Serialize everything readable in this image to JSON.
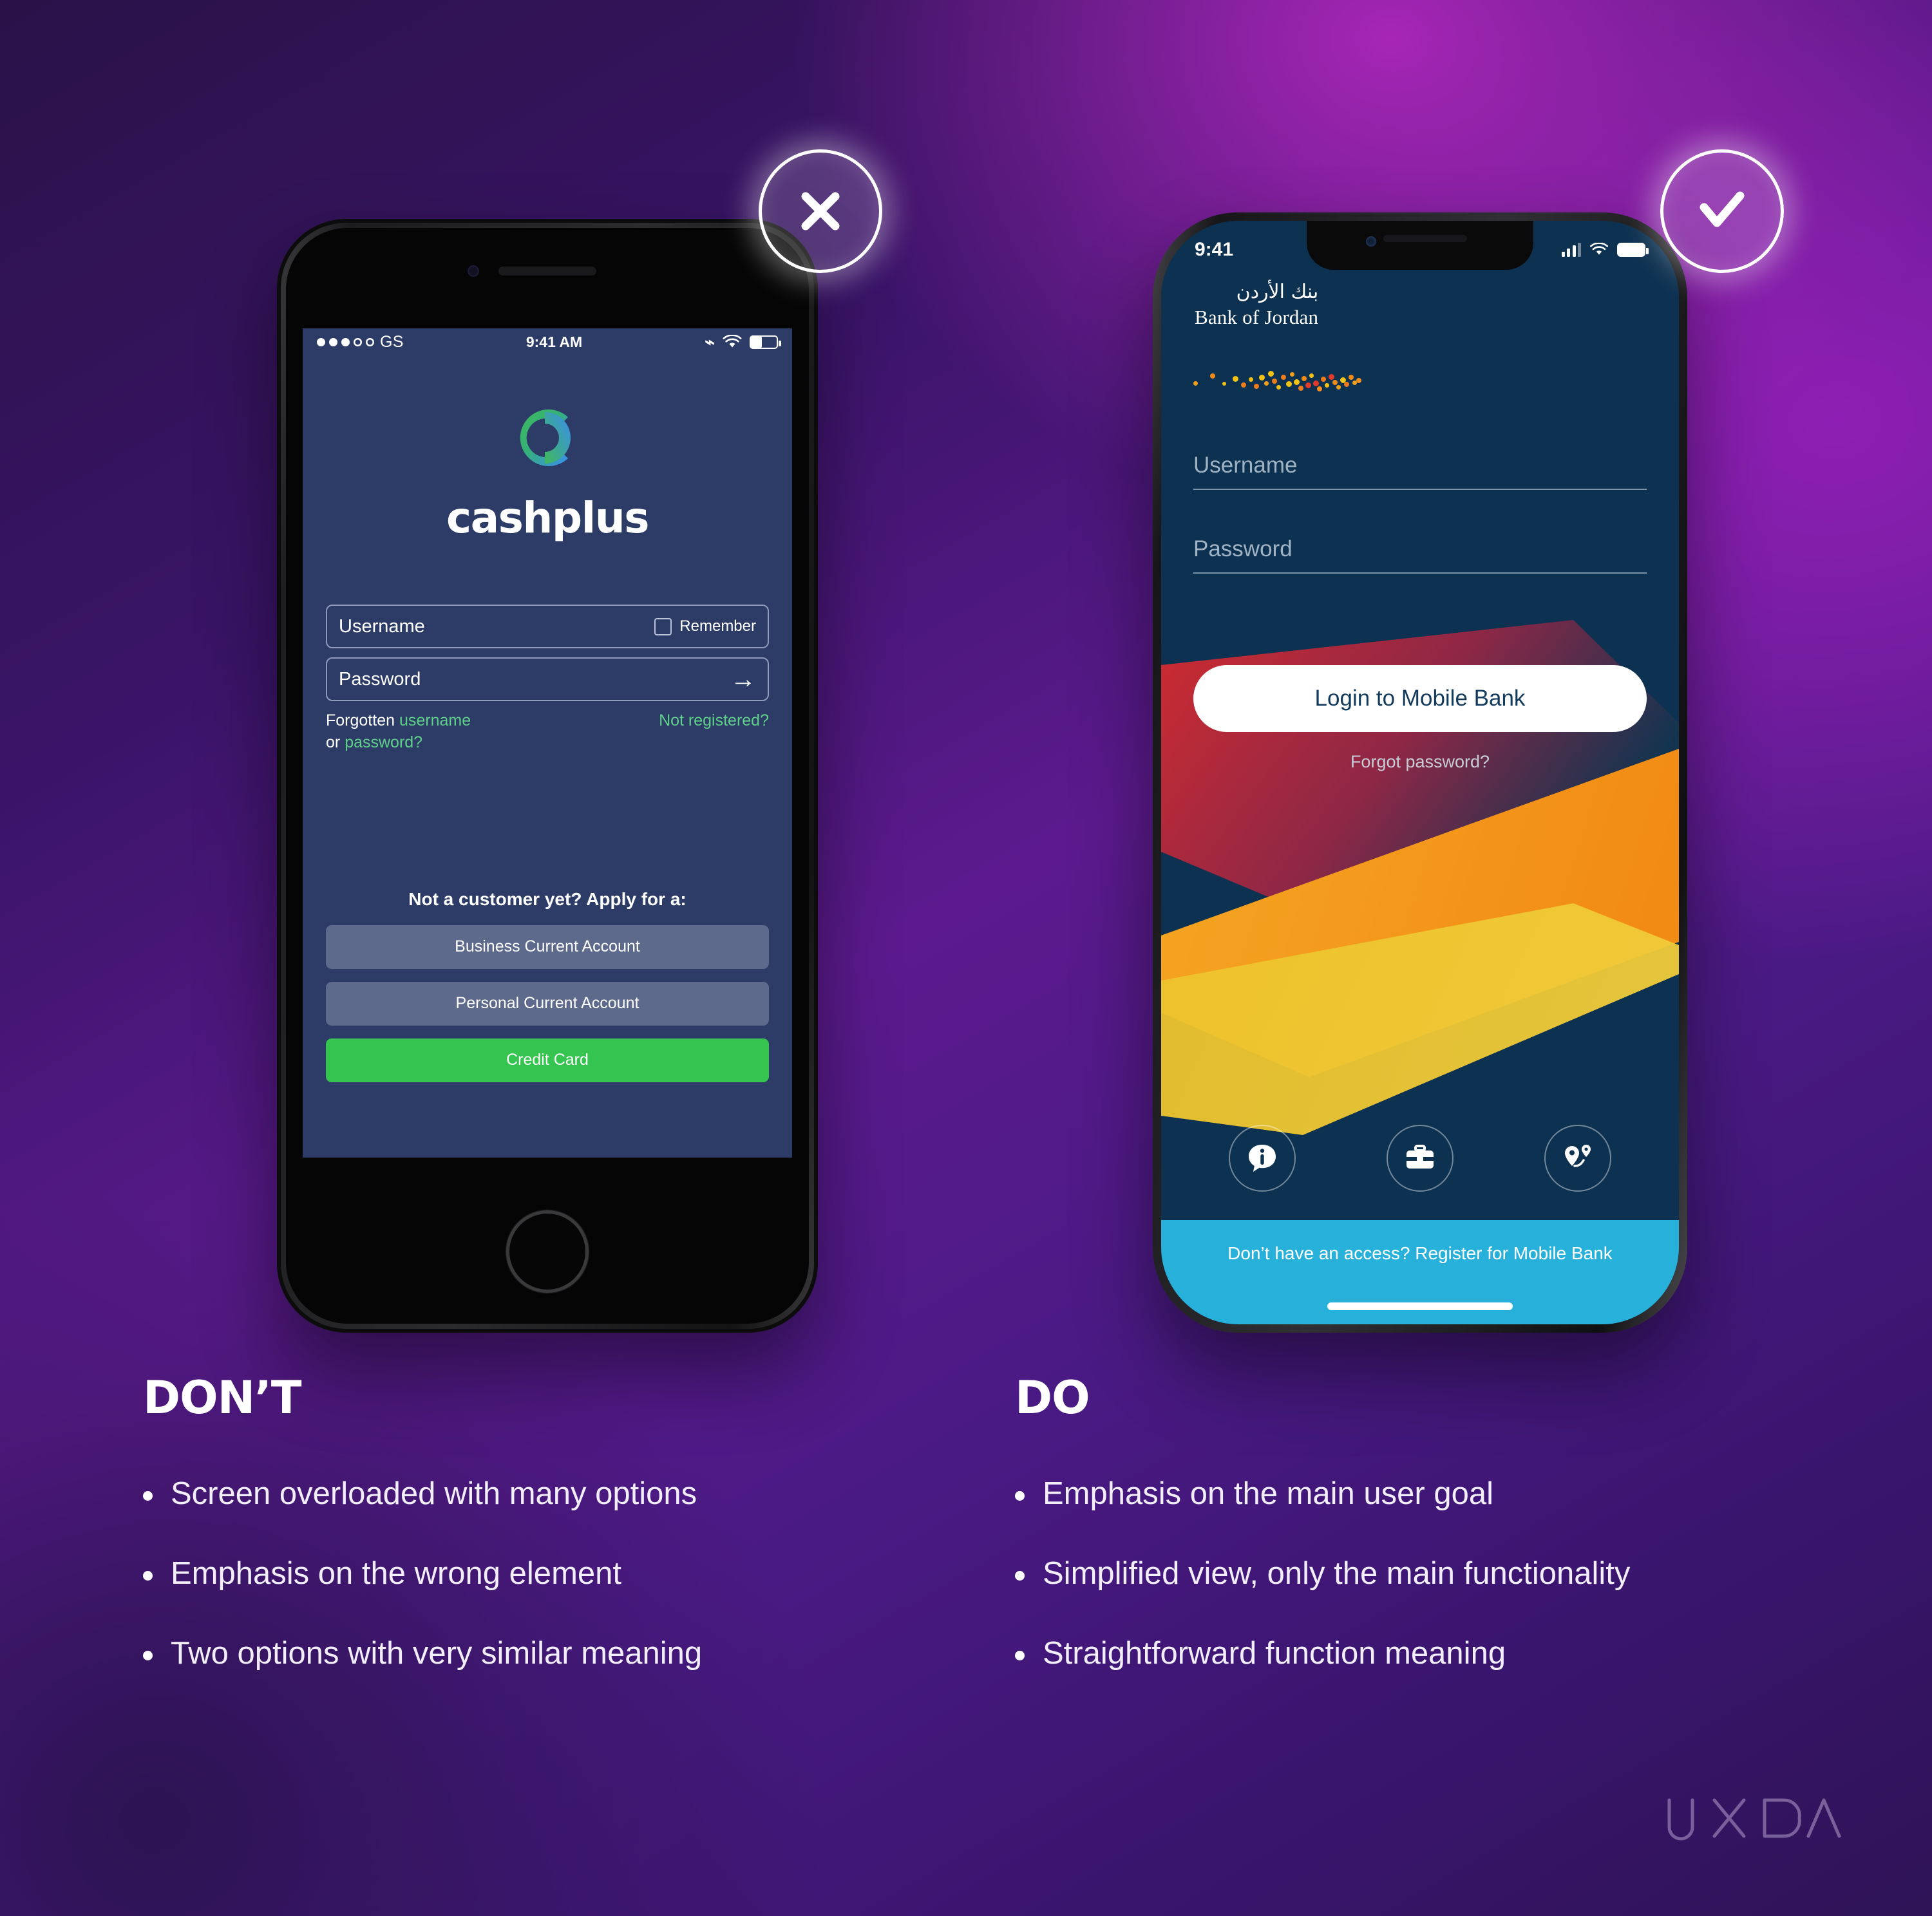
{
  "badges": {
    "dont_icon": "close-x-icon",
    "do_icon": "checkmark-icon"
  },
  "left_phone": {
    "device": "iphone-8",
    "status_bar": {
      "carrier": "GS",
      "time": "9:41 AM",
      "bluetooth_icon": "bluetooth-icon",
      "wifi_icon": "wifi-icon",
      "battery_icon": "battery-icon"
    },
    "brand": {
      "wordmark": "cashplus",
      "logo_icon": "cashplus-c-logo"
    },
    "form": {
      "username_placeholder": "Username",
      "remember_label": "Remember",
      "password_placeholder": "Password",
      "submit_icon": "arrow-right-icon",
      "forgot_prefix": "Forgotten ",
      "forgot_username": "username",
      "forgot_middle": "or ",
      "forgot_password": "password?",
      "not_registered": "Not registered?"
    },
    "apply": {
      "heading": "Not a customer yet? Apply for a:",
      "buttons": [
        {
          "label": "Business Current Account",
          "style": "grey"
        },
        {
          "label": "Personal Current Account",
          "style": "grey"
        },
        {
          "label": "Credit Card",
          "style": "green"
        }
      ]
    },
    "colors": {
      "screen_bg": "#2c3c66",
      "accent_green": "#35c44f",
      "link_green": "#5fd08a",
      "button_grey": "#5e6a8c"
    }
  },
  "right_phone": {
    "device": "iphone-x",
    "status_bar": {
      "time": "9:41",
      "signal_icon": "cellular-bars-icon",
      "wifi_icon": "wifi-icon",
      "battery_icon": "battery-full-icon"
    },
    "brand": {
      "name_ar": "بنك الأردن",
      "name_en": "Bank of Jordan",
      "logo_icon": "dot-pattern-logo"
    },
    "form": {
      "username_label": "Username",
      "password_label": "Password"
    },
    "login_button": "Login to Mobile Bank",
    "forgot_link": "Forgot password?",
    "quick_icons": [
      {
        "name": "info-chat-icon",
        "label": "info"
      },
      {
        "name": "briefcase-icon",
        "label": "business"
      },
      {
        "name": "map-pins-icon",
        "label": "locations"
      }
    ],
    "register_banner": "Don’t have an access? Register for Mobile Bank",
    "colors": {
      "screen_bg": "#0d3150",
      "banner_blue": "#26b0da",
      "red": "#cb2b33",
      "orange": "#f08c1c",
      "yellow": "#edc028"
    }
  },
  "comparison": {
    "dont": {
      "heading": "DON’T",
      "points": [
        "Screen overloaded with many options",
        "Emphasis on the wrong element",
        "Two options with very similar meaning"
      ]
    },
    "do": {
      "heading": "DO",
      "points": [
        "Emphasis on the main user goal",
        "Simplified view, only the main functionality",
        "Straightforward function meaning"
      ]
    }
  },
  "footer": {
    "logo_text": "UXDA",
    "logo_icon": "uxda-wordmark"
  }
}
